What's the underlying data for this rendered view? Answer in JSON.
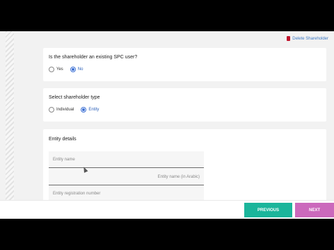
{
  "delete_link": {
    "label": "Delete Shareholder",
    "icon": "trash-icon"
  },
  "existing_user": {
    "question": "Is the shareholder an existing SPC user?",
    "options": [
      {
        "label": "Yes",
        "checked": false
      },
      {
        "label": "No",
        "checked": true
      }
    ]
  },
  "shareholder_type": {
    "question": "Select shareholder type",
    "options": [
      {
        "label": "Individual",
        "checked": false
      },
      {
        "label": "Entity",
        "checked": true
      }
    ]
  },
  "entity_details": {
    "title": "Entity details",
    "fields": [
      {
        "placeholder": "Entity name"
      },
      {
        "placeholder": "Entity name (in Arabic)"
      },
      {
        "placeholder": "Entity registration number"
      }
    ]
  },
  "footer": {
    "previous_label": "PREVIOUS",
    "next_label": "NEXT"
  },
  "colors": {
    "primary": "#1bb59b",
    "next": "#c34fb1",
    "radio": "#3b6fd4",
    "delete": "#c0142c"
  }
}
